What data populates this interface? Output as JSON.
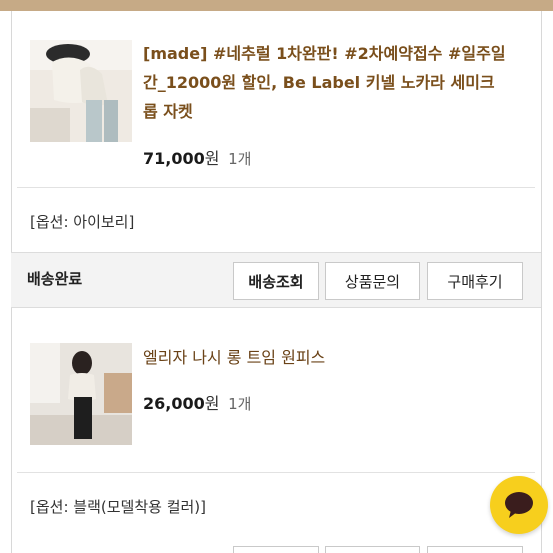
{
  "orders": [
    {
      "title": "[made] #네추럴 1차완판! #2차예약접수 #일주일간_12000원 할인, Be Label 키넬 노카라 세미크롭 자켓",
      "title_lines": [
        "[made] #네추럴 1차완판! #2차예약접수 #일주일",
        "간_12000원 할인, Be Label 키넬 노카라 세미크",
        "롭 자켓"
      ],
      "price_number": "71,000",
      "price_unit": "원",
      "quantity": "1개",
      "option": "[옵션: 아이보리]",
      "thumbnail_icon": "product-photo-icon"
    },
    {
      "title": "엘리자 나시 롱 트임 원피스",
      "price_number": "26,000",
      "price_unit": "원",
      "quantity": "1개",
      "option": "[옵션: 블랙(모델착용 컬러)]",
      "thumbnail_icon": "product-photo-icon"
    }
  ],
  "status_bar": {
    "label": "배송완료",
    "buttons": [
      "배송조회",
      "상품문의",
      "구매후기"
    ]
  },
  "chat_button": {
    "icon": "chat-bubble-icon"
  },
  "colors": {
    "title_brown": "#7a4f1c",
    "accent_bar": "#c6aa86",
    "chat_yellow": "#f7cf1d"
  }
}
